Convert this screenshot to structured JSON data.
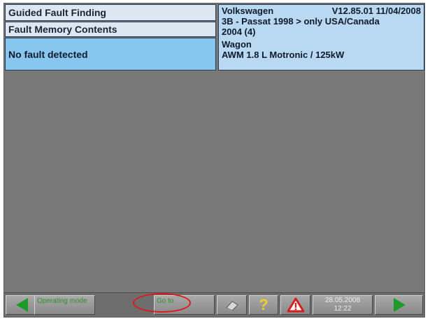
{
  "header": {
    "mode_title": "Guided Fault Finding",
    "function_title": "Fault Memory Contents",
    "status_message": "No fault detected"
  },
  "vehicle": {
    "make": "Volkswagen",
    "version": "V12.85.01 11/04/2008",
    "model": "3B - Passat 1998 > only USA/Canada",
    "model_year": "2004 (4)",
    "body_type": "Wagon",
    "engine": "AWM 1.8 L Motronic / 125kW"
  },
  "toolbar": {
    "operating_mode_label": "Operating mode",
    "goto_label": "Go to",
    "date": "28.05.2008",
    "time": "12:22",
    "help_symbol": "?"
  },
  "icons": {
    "back": "arrow-left-icon",
    "forward": "arrow-right-icon",
    "print": "eraser-icon",
    "help": "question-icon",
    "warning": "warning-icon"
  },
  "colors": {
    "screen_bg": "#787878",
    "header_light": "#dde7f1",
    "status_highlight": "#87c6ef",
    "vehicle_panel": "#b9d8f1",
    "nav_arrow": "#1c9b2a",
    "label_green": "#2d8f2d",
    "annotation_circle": "#e01818"
  }
}
